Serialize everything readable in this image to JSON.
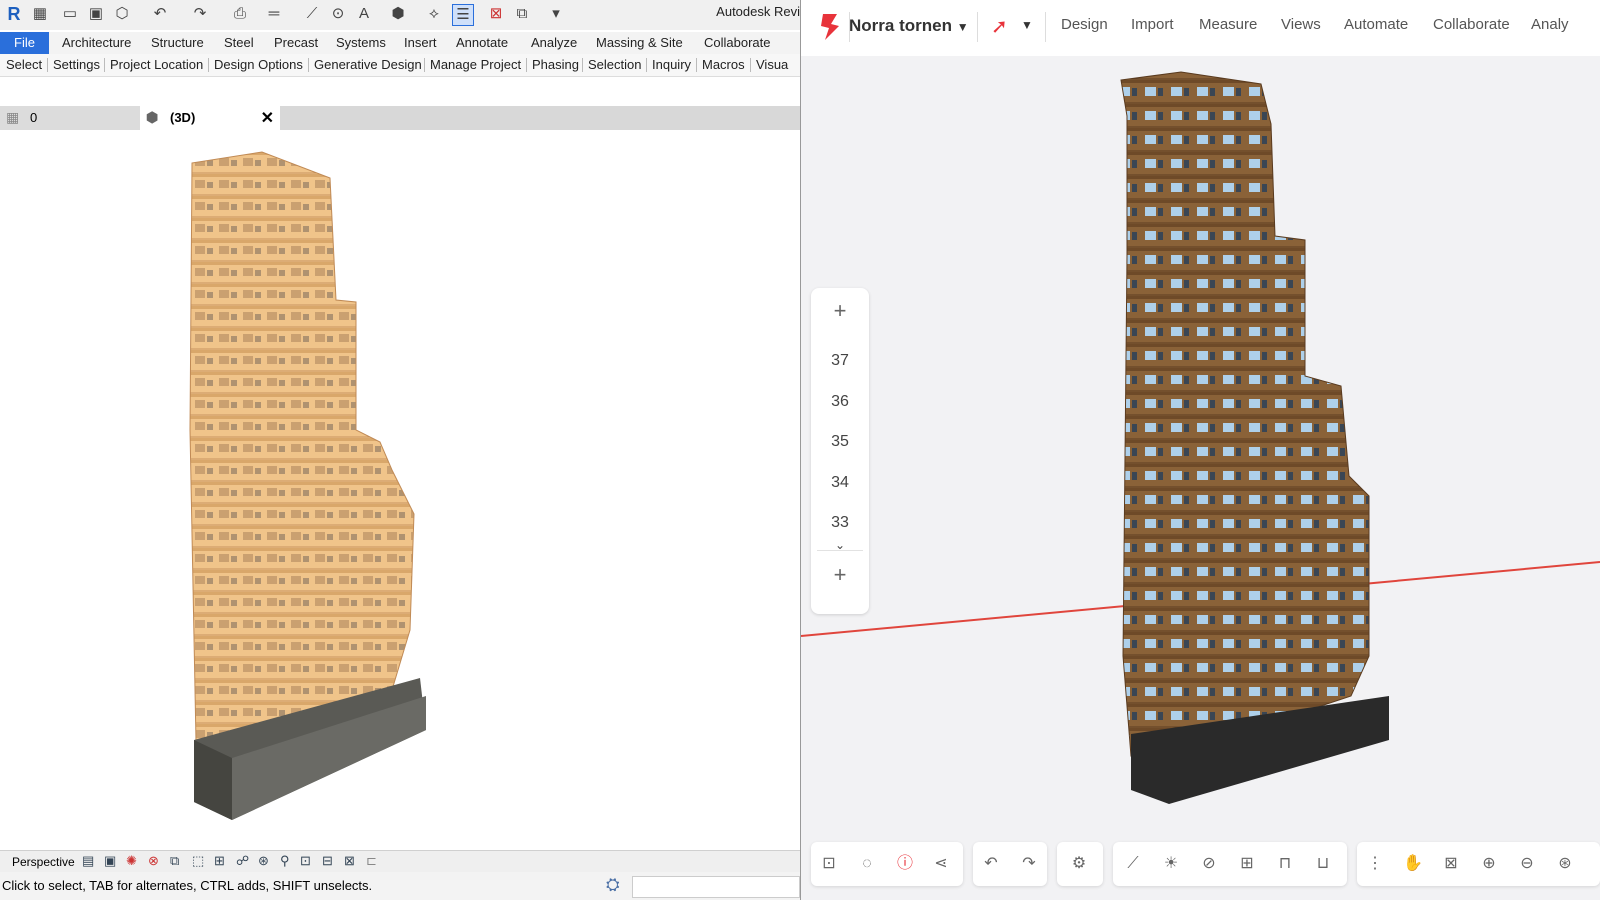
{
  "revit": {
    "title": "Autodesk Revi",
    "ribbon_tabs": [
      "File",
      "Architecture",
      "Structure",
      "Steel",
      "Precast",
      "Systems",
      "Insert",
      "Annotate",
      "Analyze",
      "Massing & Site",
      "Collaborate"
    ],
    "sub_tabs": [
      "Select",
      "Settings",
      "Project Location",
      "Design Options",
      "Generative Design",
      "Manage Project",
      "Phasing",
      "Selection",
      "Inquiry",
      "Macros",
      "Visua"
    ],
    "view_tabs": {
      "first": "0",
      "active": "(3D)"
    },
    "view_control": {
      "mode": "Perspective"
    },
    "status": "Click to select, TAB for alternates, CTRL adds, SHIFT unselects."
  },
  "viewer": {
    "project_name": "Norra tornen",
    "nav": [
      "Design",
      "Import",
      "Measure",
      "Views",
      "Automate",
      "Collaborate",
      "Analy"
    ],
    "levels": [
      "37",
      "36",
      "35",
      "34",
      "33"
    ],
    "accent": "#e8333b"
  }
}
